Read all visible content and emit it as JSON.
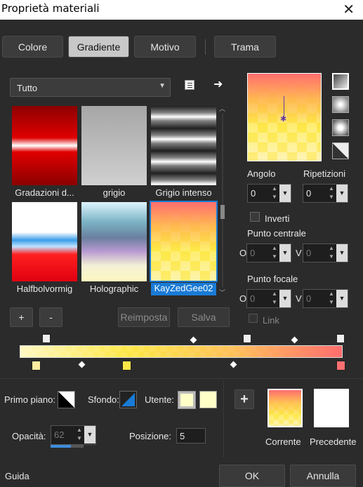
{
  "window": {
    "title": "Proprietà materiali"
  },
  "tabs": [
    {
      "label": "Colore"
    },
    {
      "label": "Gradiente",
      "active": true
    },
    {
      "label": "Motivo"
    },
    {
      "label": "Trama"
    }
  ],
  "library": {
    "category": "Tutto",
    "items": [
      {
        "label": "Gradazioni d..."
      },
      {
        "label": "grigio"
      },
      {
        "label": "Grigio intenso"
      },
      {
        "label": "Halfbolvormig"
      },
      {
        "label": "Holographic"
      },
      {
        "label": "KayZedGee02",
        "selected": true
      }
    ],
    "add_label": "+",
    "remove_label": "-",
    "reset_label": "Reimposta",
    "save_label": "Salva"
  },
  "gradient_settings": {
    "angle_label": "Angolo",
    "angle_value": "0",
    "repeats_label": "Ripetizioni",
    "repeats_value": "0",
    "invert_label": "Inverti",
    "center_label": "Punto centrale",
    "center_h_label": "O",
    "center_h_value": "0",
    "center_v_label": "V",
    "center_v_value": "0",
    "focal_label": "Punto focale",
    "focal_h_label": "O",
    "focal_h_value": "0",
    "focal_v_label": "V",
    "focal_v_value": "0",
    "link_label": "Link"
  },
  "bottom": {
    "foreground_label": "Primo piano:",
    "background_label": "Sfondo:",
    "user_label": "Utente:",
    "opacity_label": "Opacità:",
    "opacity_value": "62",
    "opacity_fraction": 0.62,
    "position_label": "Posizione:",
    "position_value": "5",
    "add_label": "+",
    "current_label": "Corrente",
    "previous_label": "Precedente"
  },
  "footer": {
    "help_label": "Guida",
    "ok_label": "OK",
    "cancel_label": "Annulla"
  },
  "colors": {
    "gradient_start": "#ffeea0",
    "gradient_mid": "#fde847",
    "gradient_end": "#ff6f6f",
    "accent": "#1a7bd6",
    "user_color": "#ffffc8"
  }
}
